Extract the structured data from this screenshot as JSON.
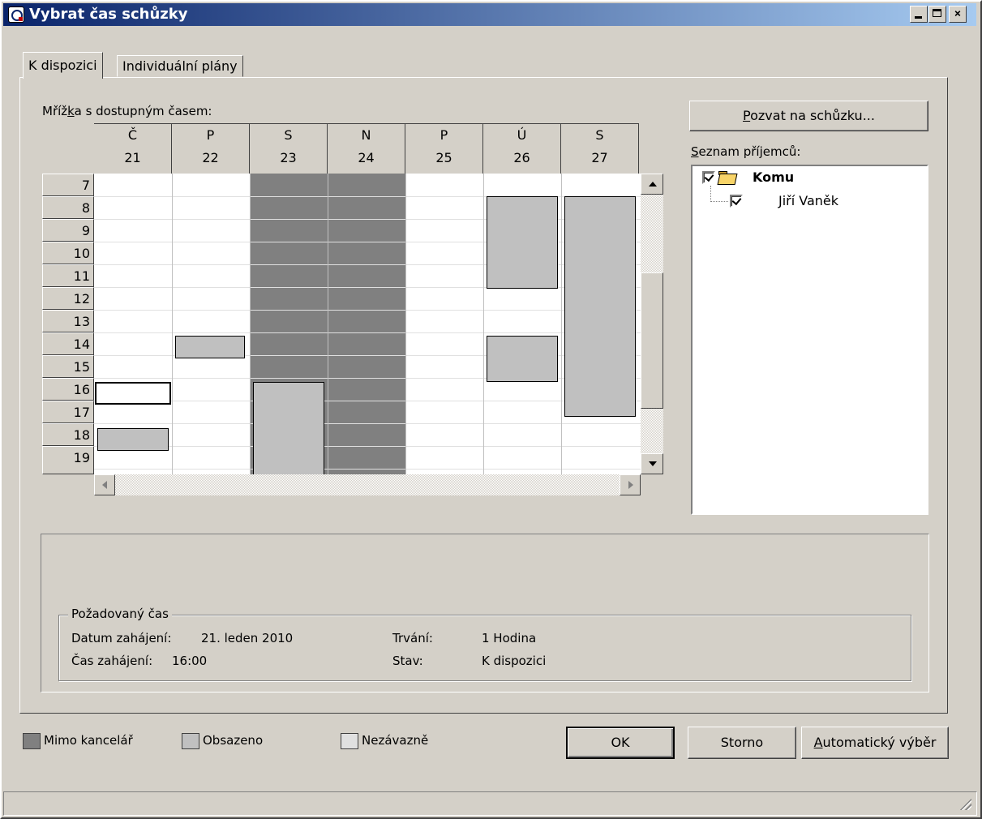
{
  "window": {
    "title": "Vybrat čas schůzky",
    "minimize": "",
    "maximize": "",
    "close": "×"
  },
  "tabs": [
    {
      "label": "K dispozici",
      "active": true
    },
    {
      "label": "Individuální plány",
      "active": false
    }
  ],
  "grid": {
    "label_pre": "Mříž",
    "label_ul": "k",
    "label_mid": "a",
    "label_post": " s dostupným časem:",
    "days": [
      {
        "dow": "Č",
        "day": "21"
      },
      {
        "dow": "P",
        "day": "22"
      },
      {
        "dow": "S",
        "day": "23"
      },
      {
        "dow": "N",
        "day": "24"
      },
      {
        "dow": "P",
        "day": "25"
      },
      {
        "dow": "Ú",
        "day": "26"
      },
      {
        "dow": "S",
        "day": "27"
      }
    ],
    "hours": [
      "7",
      "8",
      "9",
      "10",
      "11",
      "12",
      "13",
      "14",
      "15",
      "16",
      "17",
      "18",
      "19"
    ]
  },
  "invite_button": {
    "ul": "P",
    "rest": "ozvat na schůzku..."
  },
  "recipients": {
    "label_ul": "S",
    "label_rest": "eznam příjemců:",
    "group": "Komu",
    "items": [
      "Jiří Vaněk"
    ]
  },
  "requested_time": {
    "title": "Požadovaný čas",
    "start_date_label": "Datum zahájení:",
    "start_date_value": "21. leden 2010",
    "start_time_label": "Čas zahájení:",
    "start_time_value": "16:00",
    "duration_label": "Trvání:",
    "duration_value": "1 Hodina",
    "status_label": "Stav:",
    "status_value": "K dispozici"
  },
  "legend": [
    {
      "label": "Mimo kancelář",
      "color": "#808080"
    },
    {
      "label": "Obsazeno",
      "color": "#c0c0c0"
    },
    {
      "label": "Nezávazně",
      "color": "#e0e0e0"
    }
  ],
  "buttons": {
    "ok": "OK",
    "cancel": "Storno",
    "auto_ul": "A",
    "auto_rest": "utomatický výběr"
  }
}
